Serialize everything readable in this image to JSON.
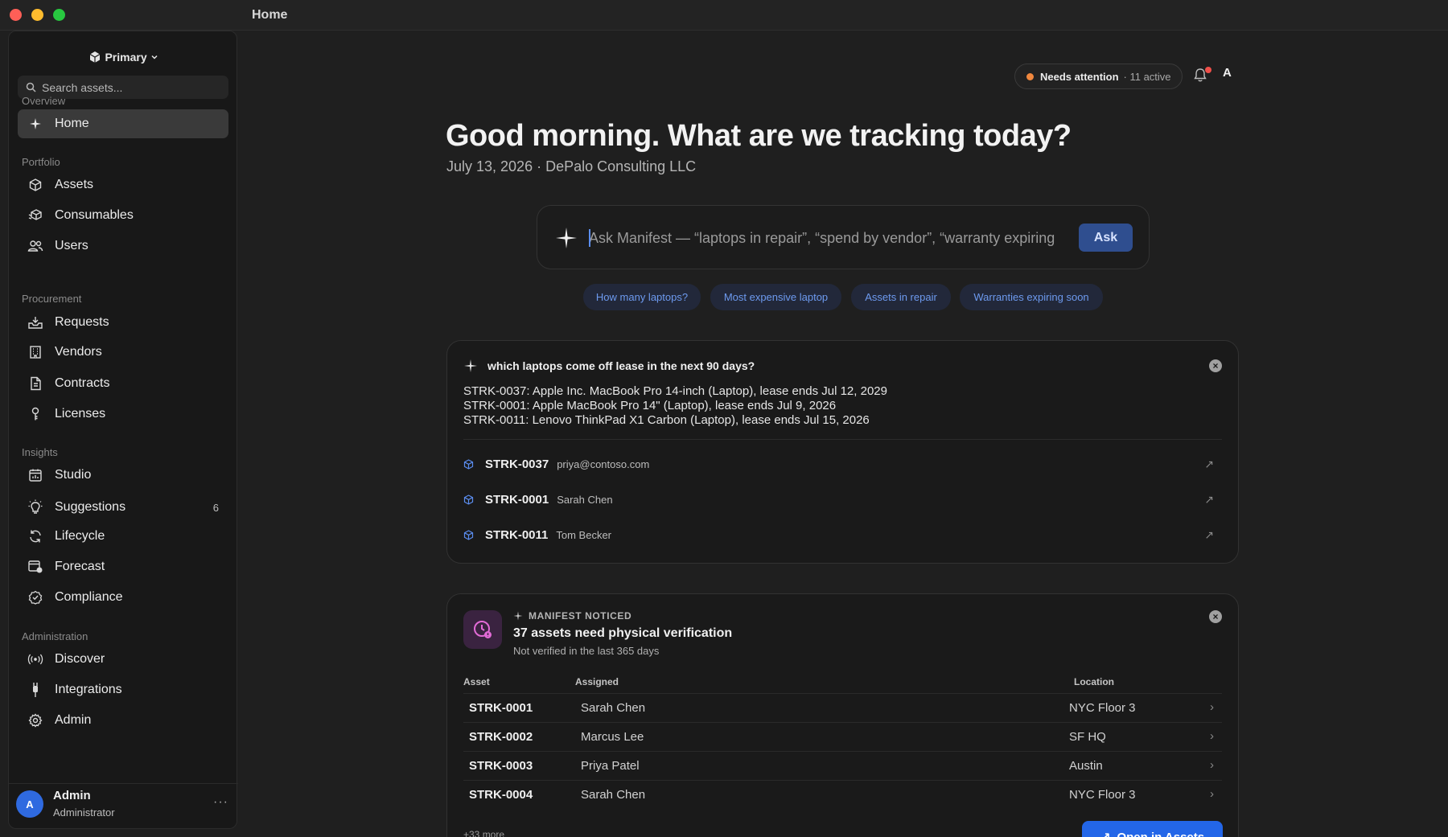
{
  "window": {
    "title": "Home"
  },
  "sidebar": {
    "workspace": "Primary",
    "search_placeholder": "Search assets...",
    "sections": {
      "overview": "Overview",
      "portfolio": "Portfolio",
      "procurement": "Procurement",
      "insights": "Insights",
      "administration": "Administration"
    },
    "items": {
      "home": "Home",
      "assets": "Assets",
      "consumables": "Consumables",
      "users": "Users",
      "requests": "Requests",
      "vendors": "Vendors",
      "contracts": "Contracts",
      "licenses": "Licenses",
      "studio": "Studio",
      "suggestions": "Suggestions",
      "suggestions_badge": "6",
      "lifecycle": "Lifecycle",
      "forecast": "Forecast",
      "compliance": "Compliance",
      "discover": "Discover",
      "integrations": "Integrations",
      "admin": "Admin"
    },
    "user": {
      "initial": "A",
      "name": "Admin",
      "role": "Administrator",
      "more": "···"
    }
  },
  "topbar": {
    "status_label": "Needs attention",
    "status_count": "· 11 active",
    "avatar_initial": "A",
    "status_color": "#f0883e"
  },
  "header": {
    "greeting": "Good morning. What are we tracking today?",
    "subline": "July 13, 2026 · DePalo Consulting LLC"
  },
  "ask": {
    "placeholder": "Ask Manifest — “laptops in repair”, “spend by vendor”, “warranty expiring",
    "button": "Ask",
    "chips": [
      "How many laptops?",
      "Most expensive laptop",
      "Assets in repair",
      "Warranties expiring soon"
    ]
  },
  "answer_card": {
    "question": "which laptops come off lease in the next 90 days?",
    "lines": [
      "STRK-0037: Apple Inc. MacBook Pro 14-inch (Laptop), lease ends Jul 12, 2029",
      "STRK-0001: Apple MacBook Pro 14\" (Laptop), lease ends Jul 9, 2026",
      "STRK-0011: Lenovo ThinkPad X1 Carbon (Laptop), lease ends Jul 15, 2026"
    ],
    "assets": [
      {
        "id": "STRK-0037",
        "who": "priya@contoso.com"
      },
      {
        "id": "STRK-0001",
        "who": "Sarah Chen"
      },
      {
        "id": "STRK-0011",
        "who": "Tom Becker"
      }
    ]
  },
  "notice_card": {
    "kicker": "MANIFEST NOTICED",
    "title": "37 assets need physical verification",
    "subtitle": "Not verified in the last 365 days",
    "columns": {
      "asset": "Asset",
      "assigned": "Assigned",
      "location": "Location"
    },
    "rows": [
      {
        "asset": "STRK-0001",
        "assigned": "Sarah Chen",
        "location": "NYC Floor 3"
      },
      {
        "asset": "STRK-0002",
        "assigned": "Marcus Lee",
        "location": "SF HQ"
      },
      {
        "asset": "STRK-0003",
        "assigned": "Priya Patel",
        "location": "Austin"
      },
      {
        "asset": "STRK-0004",
        "assigned": "Sarah Chen",
        "location": "NYC Floor 3"
      }
    ],
    "more": "+33 more",
    "open_button": "Open in Assets"
  }
}
